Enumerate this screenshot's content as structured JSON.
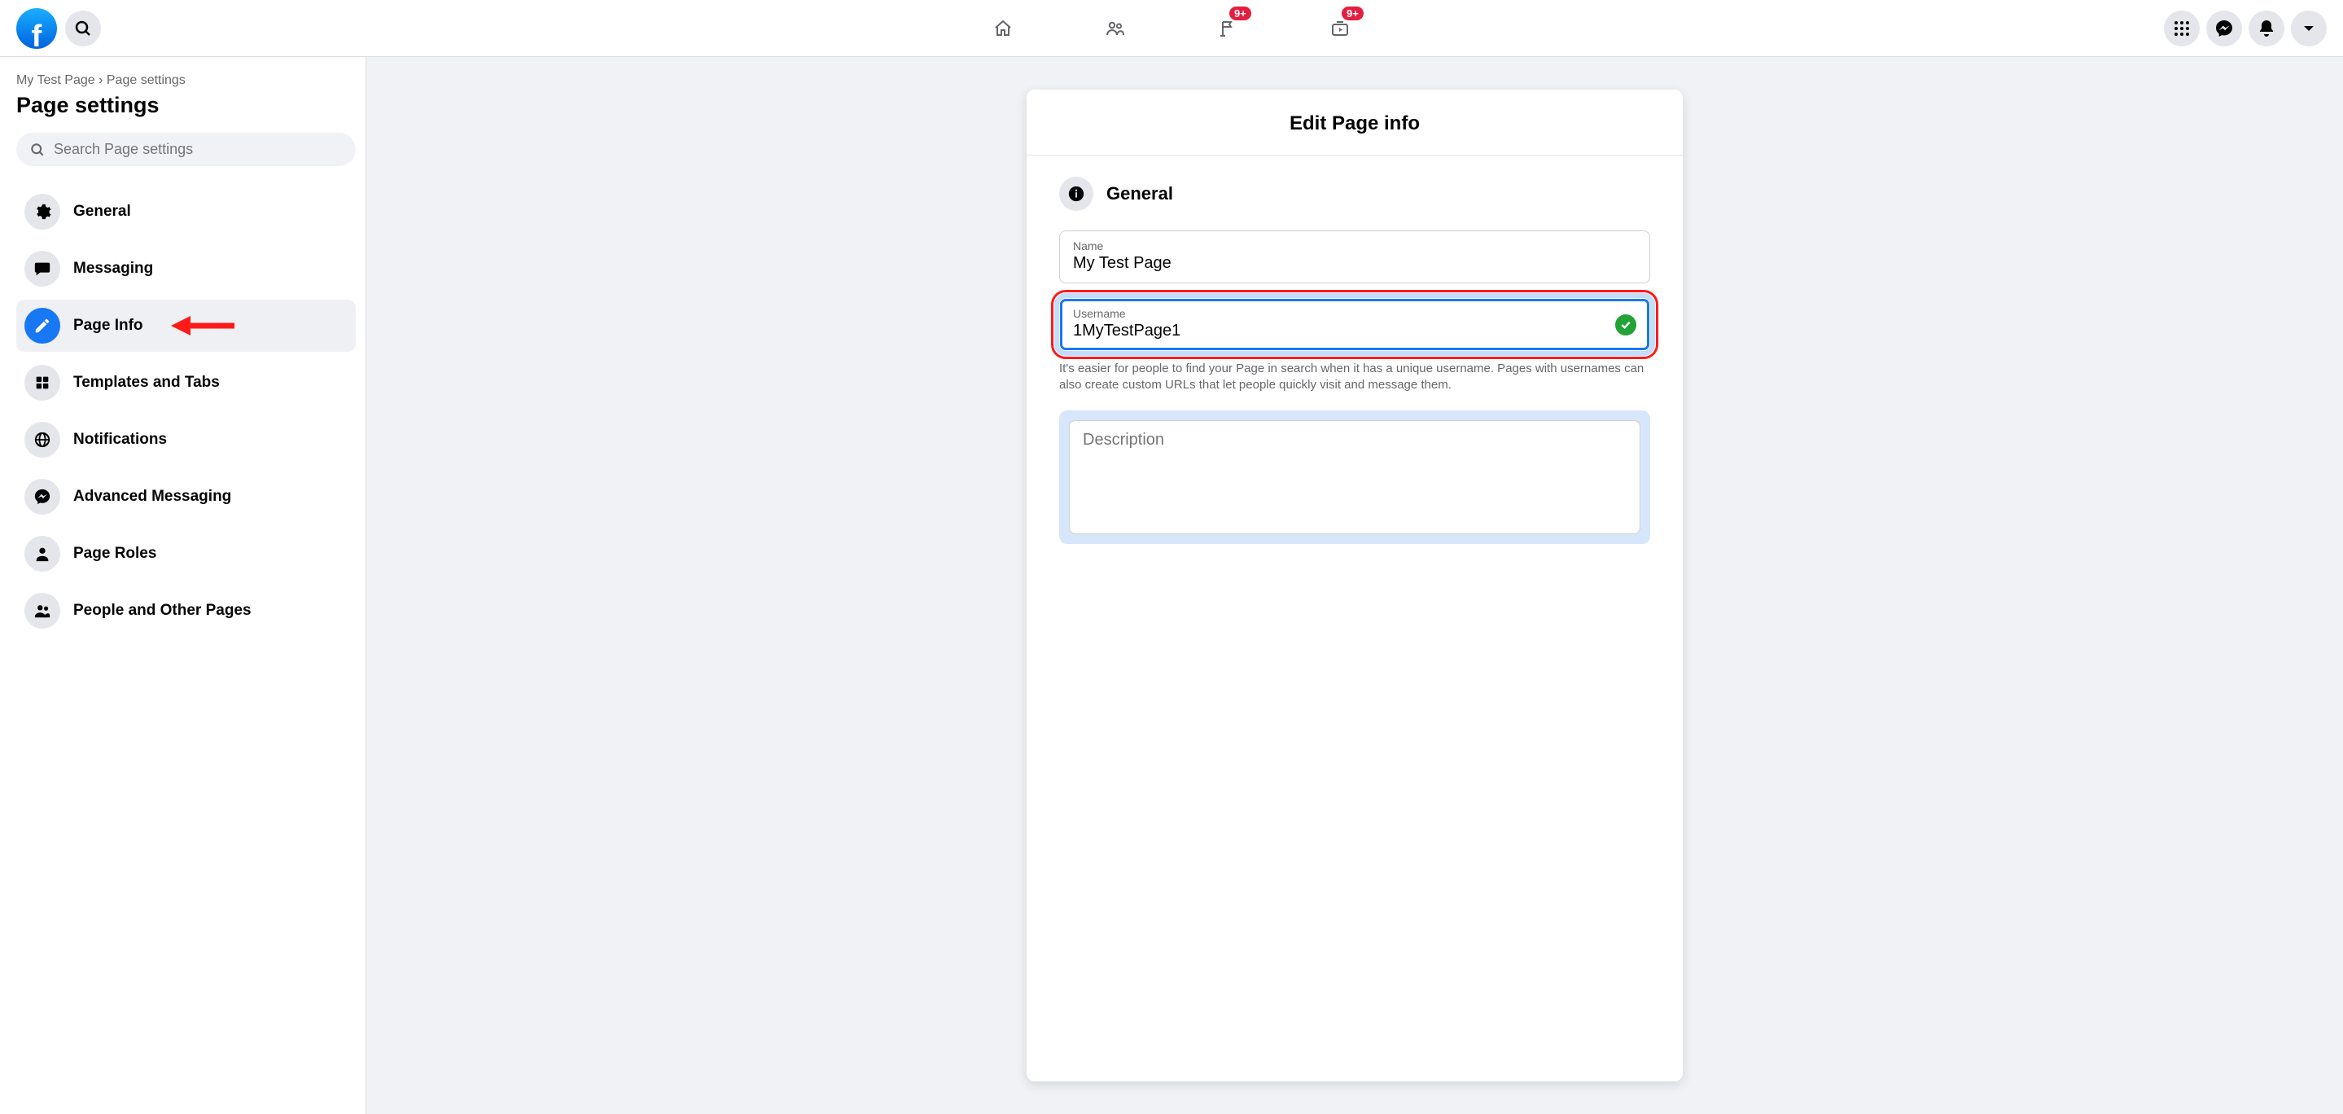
{
  "header": {
    "badges": {
      "groups": "9+",
      "watch": "9+"
    }
  },
  "breadcrumb": {
    "page_name": "My Test Page",
    "sep": "›",
    "current": "Page settings"
  },
  "sidebar": {
    "title": "Page settings",
    "search_placeholder": "Search Page settings",
    "items": [
      {
        "key": "general",
        "label": "General"
      },
      {
        "key": "messaging",
        "label": "Messaging"
      },
      {
        "key": "page-info",
        "label": "Page Info"
      },
      {
        "key": "templates-tabs",
        "label": "Templates and Tabs"
      },
      {
        "key": "notifications",
        "label": "Notifications"
      },
      {
        "key": "advanced-messaging",
        "label": "Advanced Messaging"
      },
      {
        "key": "page-roles",
        "label": "Page Roles"
      },
      {
        "key": "people-pages",
        "label": "People and Other Pages"
      }
    ]
  },
  "main": {
    "card_title": "Edit Page info",
    "section_title": "General",
    "name_label": "Name",
    "name_value": "My Test Page",
    "username_label": "Username",
    "username_value": "1MyTestPage1",
    "username_helper": "It's easier for people to find your Page in search when it has a unique username. Pages with usernames can also create custom URLs that let people quickly visit and message them.",
    "description_placeholder": "Description"
  }
}
